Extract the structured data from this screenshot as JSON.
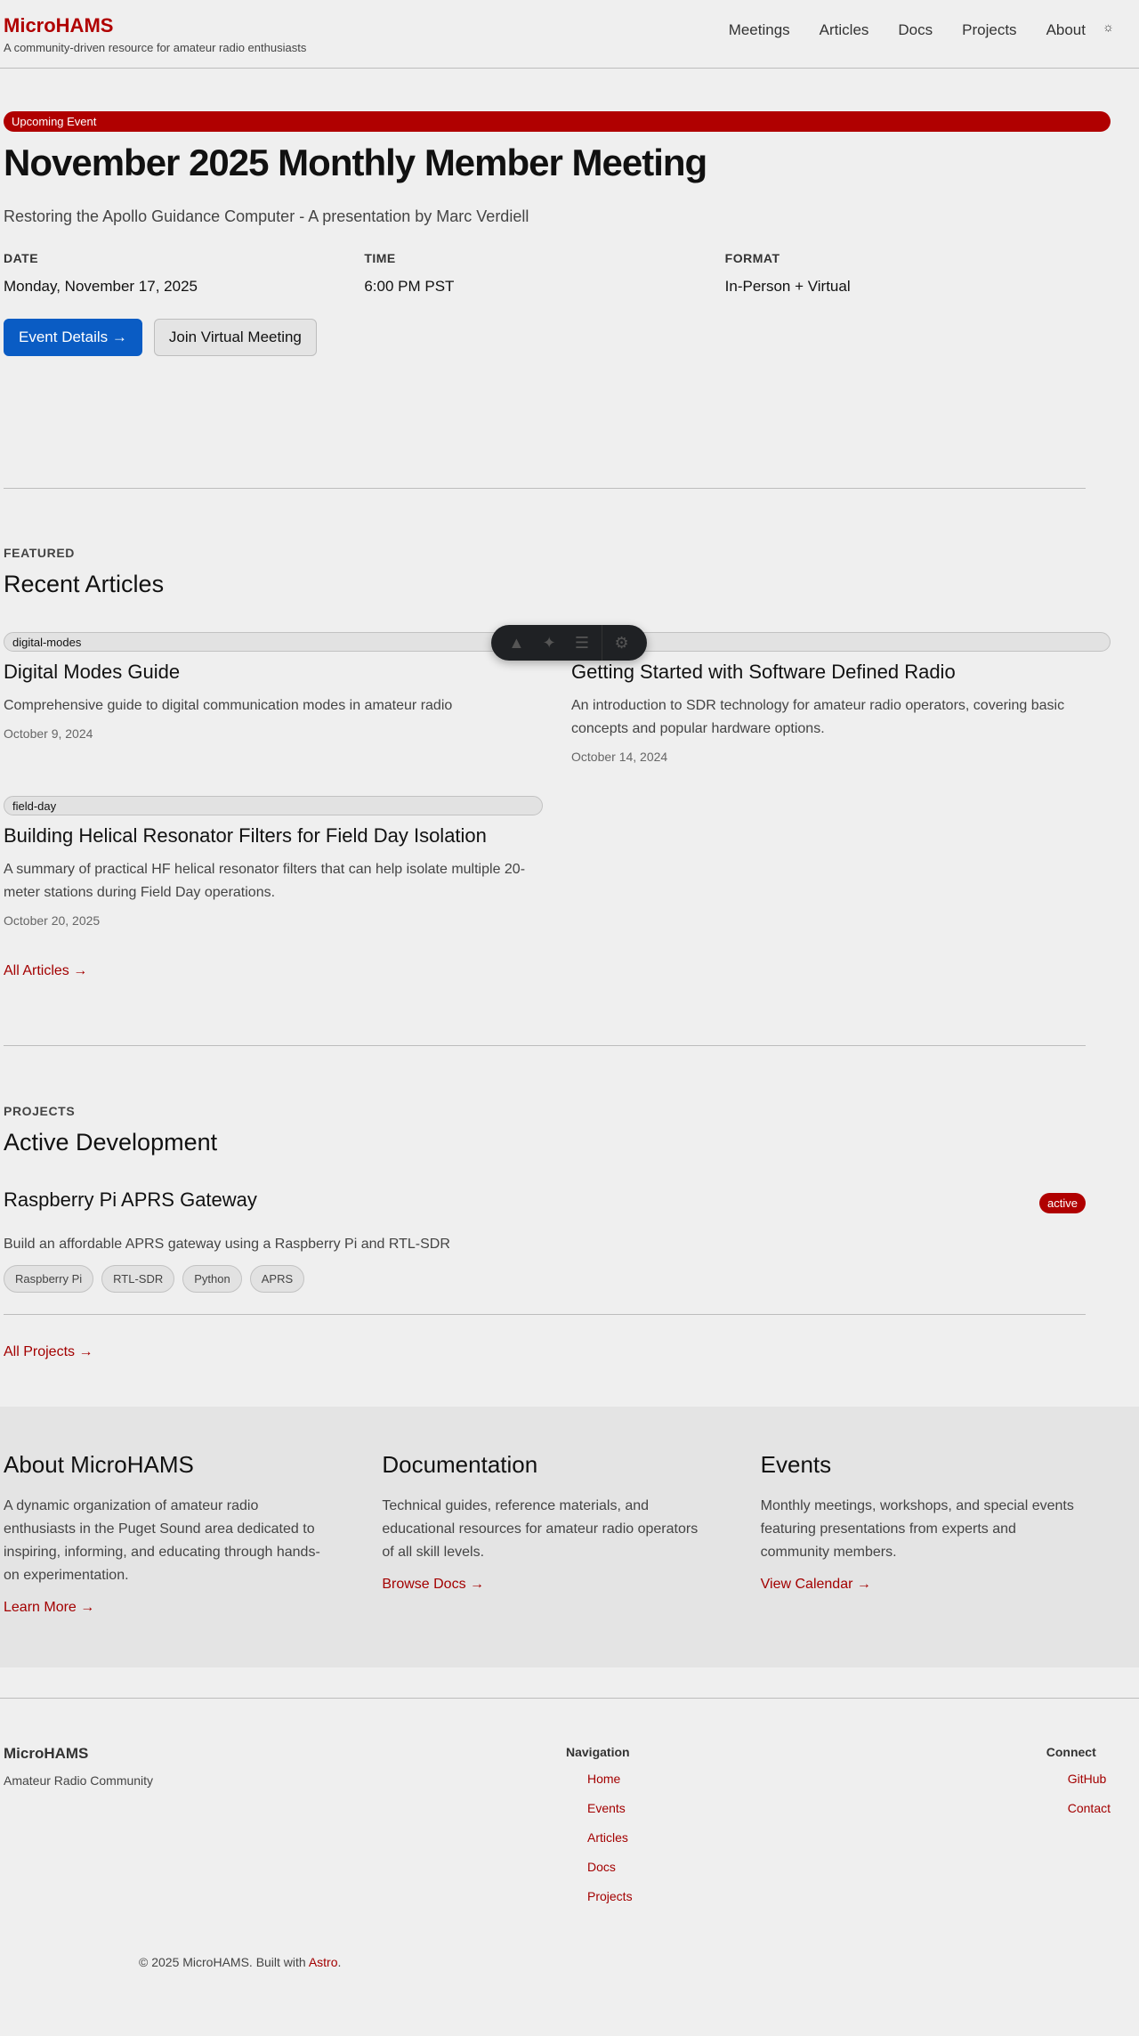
{
  "header": {
    "site_title": "MicroHAMS",
    "tagline": "A community-driven resource for amateur radio enthusiasts",
    "nav": [
      "Meetings",
      "Articles",
      "Docs",
      "Projects",
      "About"
    ],
    "theme_icon": "☼"
  },
  "hero": {
    "badge": "Upcoming Event",
    "title": "November 2025 Monthly Member Meeting",
    "subtitle": "Restoring the Apollo Guidance Computer - A presentation by Marc Verdiell",
    "meta": [
      {
        "label": "DATE",
        "value": "Monday, November 17, 2025"
      },
      {
        "label": "TIME",
        "value": "6:00 PM PST"
      },
      {
        "label": "FORMAT",
        "value": "In-Person + Virtual"
      }
    ],
    "primary_button": "Event Details →",
    "secondary_button": "Join Virtual Meeting"
  },
  "articles": {
    "kicker": "FEATURED",
    "title": "Recent Articles",
    "items": [
      {
        "tag": "digital-modes",
        "title": "Digital Modes Guide",
        "summary": "Comprehensive guide to digital communication modes in amateur radio",
        "date": "October 9, 2024"
      },
      {
        "tag": "sdr",
        "title": "Getting Started with Software Defined Radio",
        "summary": "An introduction to SDR technology for amateur radio operators, covering basic concepts and popular hardware options.",
        "date": "October 14, 2024"
      },
      {
        "tag": "field-day",
        "title": "Building Helical Resonator Filters for Field Day Isolation",
        "summary": "A summary of practical HF helical resonator filters that can help isolate multiple 20-meter stations during Field Day operations.",
        "date": "October 20, 2025"
      }
    ],
    "all_link": "All Articles →"
  },
  "projects": {
    "kicker": "PROJECTS",
    "title": "Active Development",
    "item": {
      "title": "Raspberry Pi APRS Gateway",
      "status": "active",
      "summary": "Build an affordable APRS gateway using a Raspberry Pi and RTL-SDR",
      "chips": [
        "Raspberry Pi",
        "RTL-SDR",
        "Python",
        "APRS"
      ]
    },
    "all_link": "All Projects →"
  },
  "band": [
    {
      "title": "About MicroHAMS",
      "text": "A dynamic organization of amateur radio enthusiasts in the Puget Sound area dedicated to inspiring, informing, and educating through hands-on experimentation.",
      "link": "Learn More →"
    },
    {
      "title": "Documentation",
      "text": "Technical guides, reference materials, and educational resources for amateur radio operators of all skill levels.",
      "link": "Browse Docs →"
    },
    {
      "title": "Events",
      "text": "Monthly meetings, workshops, and special events featuring presentations from experts and community members.",
      "link": "View Calendar →"
    }
  ],
  "footer": {
    "brand": "MicroHAMS",
    "brand_sub": "Amateur Radio Community",
    "nav_heading": "Navigation",
    "nav_links": [
      "Home",
      "Events",
      "Articles",
      "Docs",
      "Projects"
    ],
    "connect_heading": "Connect",
    "connect_links": [
      "GitHub",
      "Contact"
    ],
    "copyright_prefix": "© 2025 MicroHAMS. Built with ",
    "copyright_link": "Astro",
    "copyright_suffix": "."
  },
  "toolbar": {
    "icons": [
      "astro-logo-icon",
      "inspect-icon",
      "audit-icon",
      "settings-icon"
    ]
  }
}
